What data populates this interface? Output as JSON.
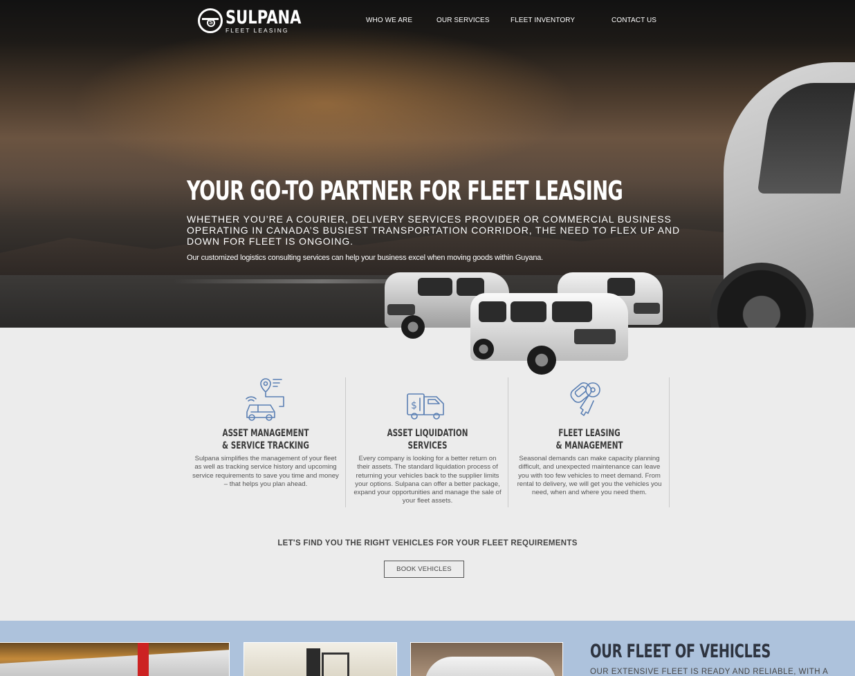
{
  "brand": {
    "name": "SULPANA",
    "tagline": "FLEET LEASING",
    "logo_icon": "steering-wheel-icon"
  },
  "nav": {
    "items": [
      {
        "label": "WHO WE ARE"
      },
      {
        "label": "OUR SERVICES"
      },
      {
        "label": "FLEET INVENTORY"
      },
      {
        "label": "CONTACT US"
      }
    ]
  },
  "hero": {
    "title": "YOUR GO-TO PARTNER FOR FLEET LEASING",
    "subtitle": "WHETHER YOU’RE A COURIER, DELIVERY SERVICES PROVIDER OR COMMERCIAL BUSINESS OPERATING IN CANADA’S BUSIEST TRANSPORTATION CORRIDOR, THE NEED TO FLEX UP AND DOWN FOR FLEET IS ONGOING.",
    "note": "Our customized logistics consulting services can help your business excel when moving goods within Guyana."
  },
  "services": [
    {
      "icon": "location-car-tracking-icon",
      "title_line1": "ASSET MANAGEMENT",
      "title_line2": "& SERVICE TRACKING",
      "description": "Sulpana simplifies the management of your fleet as well as tracking service history and upcoming service requirements to save you time and money – that helps you plan ahead."
    },
    {
      "icon": "truck-dollar-icon",
      "title_line1": "ASSET LIQUIDATION",
      "title_line2": "SERVICES",
      "description": "Every company is looking for a better return on their assets. The standard liquidation process of returning your vehicles back to the supplier limits your options. Sulpana can offer a better package, expand your opportunities and manage the sale of your fleet assets."
    },
    {
      "icon": "car-key-icon",
      "title_line1": "FLEET LEASING",
      "title_line2": "& MANAGEMENT",
      "description": "Seasonal demands can make capacity planning difficult, and unexpected maintenance can leave you with too few vehicles to meet demand. From rental to delivery, we will get you the vehicles you need, when and where you need them."
    }
  ],
  "cta": {
    "heading": "LET'S FIND YOU THE RIGHT VEHICLES FOR YOUR FLEET REQUIREMENTS",
    "button": "BOOK VEHICLES"
  },
  "fleet": {
    "title": "OUR FLEET OF VEHICLES",
    "subtitle": "OUR EXTENSIVE FLEET IS READY AND RELIABLE, WITH A"
  },
  "colors": {
    "accent_icon": "#5a7fb3",
    "fleet_band": "#adc2dc",
    "section_bg": "#ececec"
  }
}
